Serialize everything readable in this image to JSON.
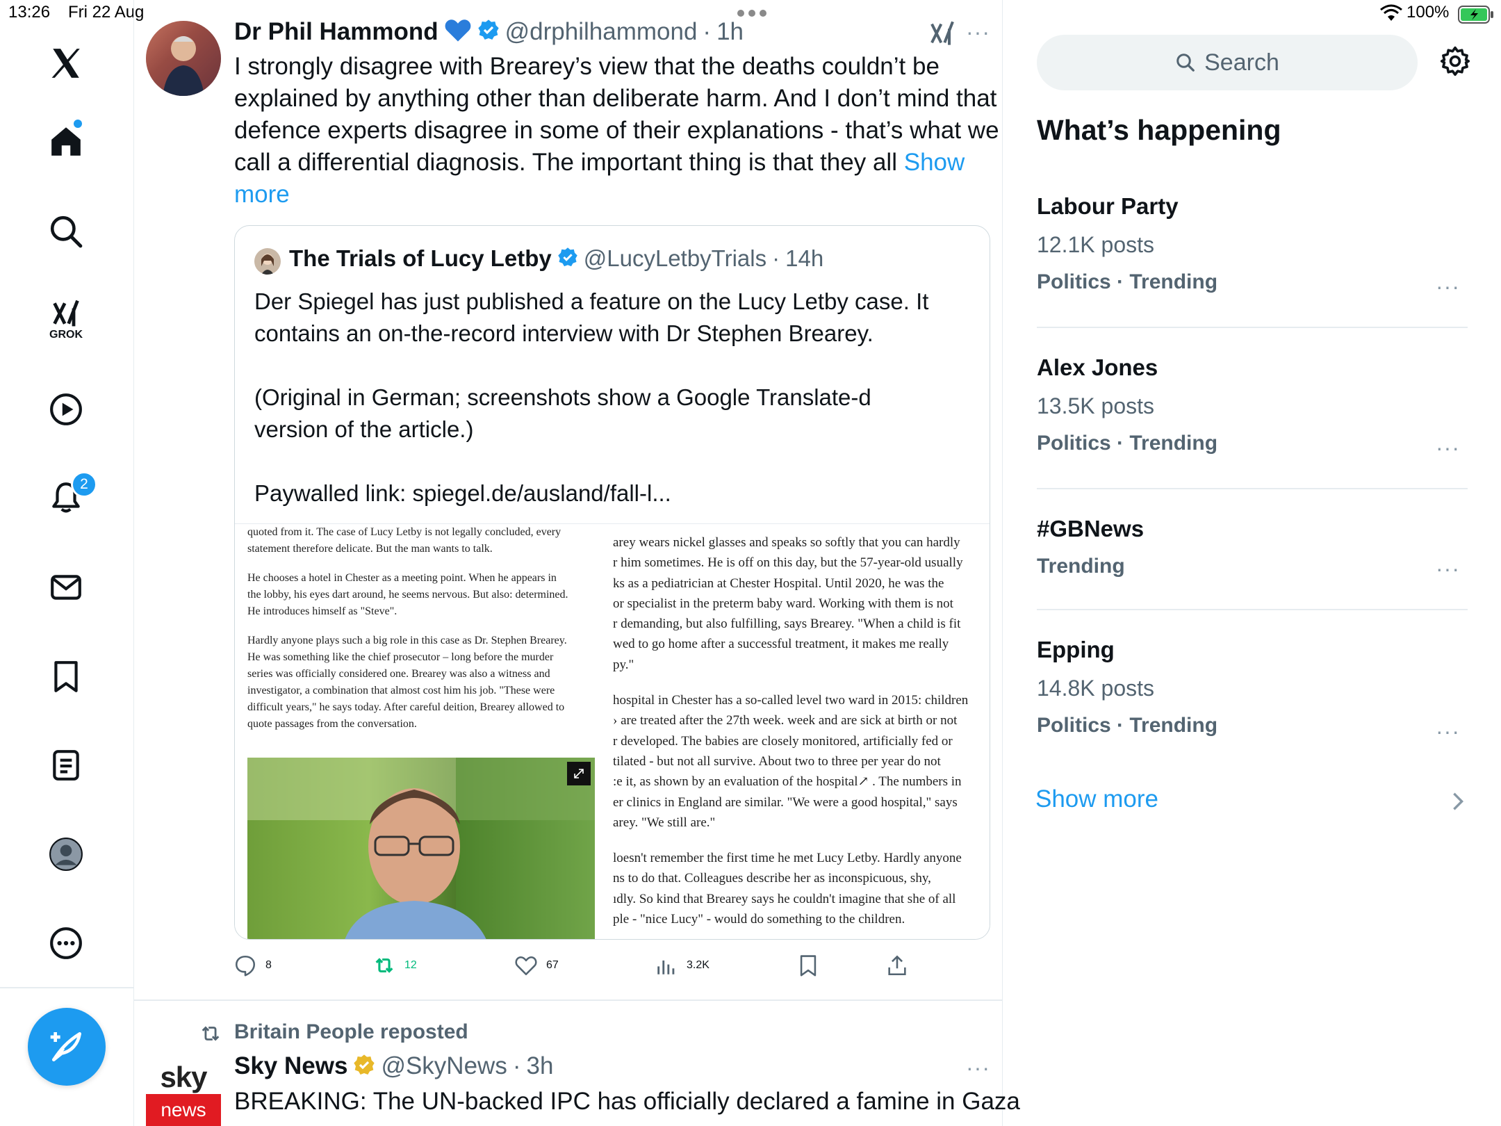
{
  "status_bar": {
    "time": "13:26",
    "date": "Fri 22 Aug",
    "battery": "100%"
  },
  "nav": {
    "grok_label": "GROK",
    "notifications_badge": "2"
  },
  "tweet": {
    "author_name": "Dr Phil Hammond",
    "handle": "@drphilhammond",
    "time": "1h",
    "body": "I strongly disagree with Brearey’s view that the deaths couldn’t be explained by anything other than deliberate harm. And I don’t mind that defence experts disagree in some of their explanations - that’s what we call a differential diagnosis. The important thing is that they all",
    "show_more": "Show more",
    "body_lines": [
      "I strongly disagree with Brearey’s view that the deaths couldn’t be",
      "explained by anything other than deliberate harm. And I don’t mind that",
      "defence experts disagree in some of their explanations - that’s what we",
      "call a differential diagnosis. The important thing is that they all"
    ],
    "show_more_1": "Show",
    "show_more_2": "more",
    "quote": {
      "author_name": "The Trials of Lucy Letby",
      "handle": "@LucyLetbyTrials",
      "time": "14h",
      "line1": "Der Spiegel has just published a feature on the Lucy Letby case. It",
      "line2": "contains an on-the-record interview with Dr Stephen Brearey.",
      "line3": "(Original in German; screenshots show a Google Translate-d",
      "line4": "version of the article.)",
      "line5": "Paywalled link: spiegel.de/ausland/fall-l..."
    },
    "article_left": [
      "quoted from it. The case of Lucy Letby is not legally concluded, every",
      "statement therefore delicate. But the man wants to talk.",
      "",
      "He chooses a hotel in Chester as a meeting point. When he appears in",
      "the lobby, his eyes dart around, he seems nervous. But also: determined.",
      "He introduces himself as \"Steve\".",
      "",
      "Hardly anyone plays such a big role in this case as Dr. Stephen Brearey.",
      "He was something like the chief prosecutor – long before the murder",
      "series was officially considered one. Brearey was also a witness and",
      "investigator, a combination that almost cost him his job. \"These were",
      "difficult years,\" he says today. After careful deition, Brearey allowed to",
      "quote passages from the conversation."
    ],
    "article_right": [
      "arey wears nickel glasses and speaks so softly that you can hardly",
      "r him sometimes. He is off on this day, but the 57-year-old usually",
      "ks as a pediatrician at Chester Hospital. Until 2020, he was the",
      "or specialist in the preterm baby ward. Working with them is not",
      "r demanding, but also fulfilling, says Brearey. \"When a child is fit",
      "wed to go home after a successful treatment, it makes me really",
      "py.\"",
      "",
      " hospital in Chester has a so-called level two ward in 2015: children",
      "› are treated after the 27th week. week and are sick at birth or not",
      "r developed. The babies are closely monitored, artificially fed or",
      "tilated - but not all survive. About two to three per year do not",
      ":e it, as shown by an evaluation of the hospital↗ . The numbers in",
      "er clinics in England are similar. \"We were a good hospital,\" says",
      "arey. \"We still are.\"",
      "",
      "loesn't remember the first time he met Lucy Letby. Hardly anyone",
      "ns to do that. Colleagues describe her as inconspicuous, shy,",
      "ıdly. So kind that Brearey says he couldn't imagine that she of all",
      "ple - \"nice Lucy\" - would do something to the children."
    ],
    "stats": {
      "replies": "8",
      "reposts": "12",
      "likes": "67",
      "views": "3.2K"
    }
  },
  "next_tweet": {
    "repost_label": "Britain People reposted",
    "author_name": "Sky News",
    "handle": "@SkyNews",
    "time": "3h",
    "logo_top": "sky",
    "logo_bottom": "news",
    "body": "BREAKING: The UN-backed IPC has officially declared a famine in Gaza"
  },
  "sidebar": {
    "search_placeholder": "Search",
    "heading": "What’s happening",
    "trends": [
      {
        "title": "Labour Party",
        "posts": "12.1K posts",
        "meta": "Politics · Trending"
      },
      {
        "title": "Alex Jones",
        "posts": "13.5K posts",
        "meta": "Politics · Trending"
      },
      {
        "title": "#GBNews",
        "posts": "",
        "meta": "Trending"
      },
      {
        "title": "Epping",
        "posts": "14.8K posts",
        "meta": "Politics · Trending"
      }
    ],
    "show_more": "Show more"
  },
  "colors": {
    "accent": "#1d9bf0",
    "repost_green": "#00ba7c",
    "muted": "#536471",
    "verified_gold": "#e8b829"
  },
  "icons": [
    "x-logo-icon",
    "home-icon",
    "search-icon",
    "grok-icon",
    "video-icon",
    "bell-icon",
    "mail-icon",
    "bookmark-icon",
    "list-icon",
    "profile-icon",
    "more-icon",
    "compose-icon",
    "gear-icon",
    "verified-icon",
    "heart-emoji-icon",
    "reply-icon",
    "repost-icon",
    "like-icon",
    "views-icon",
    "share-icon",
    "chevron-right-icon"
  ]
}
